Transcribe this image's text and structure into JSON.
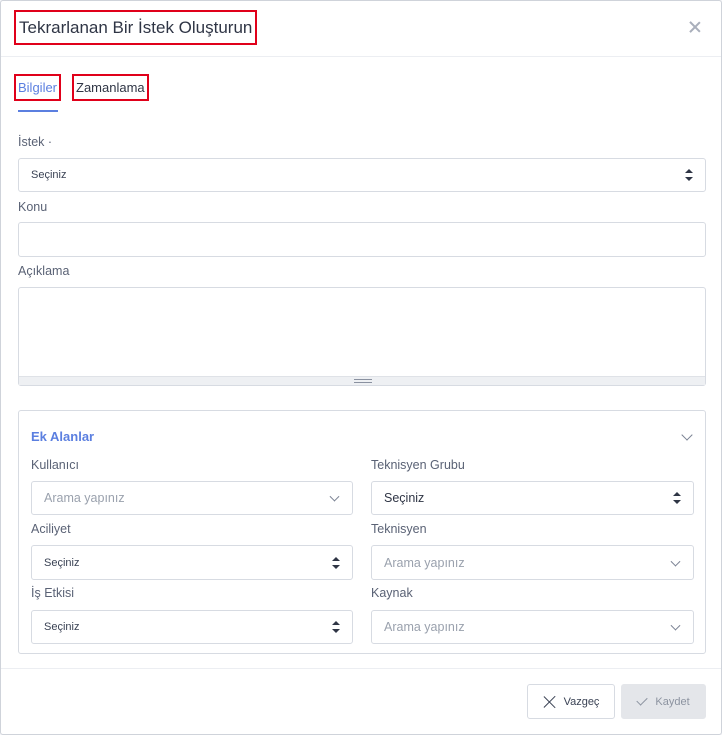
{
  "dialog": {
    "title": "Tekrarlanan Bir İstek Oluşturun"
  },
  "tabs": [
    {
      "label": "Bilgiler",
      "active": true
    },
    {
      "label": "Zamanlama",
      "active": false
    }
  ],
  "form": {
    "request_label": "İstek ·",
    "request_value": "Seçiniz",
    "subject_label": "Konu",
    "subject_value": "",
    "description_label": "Açıklama",
    "description_value": ""
  },
  "extra_fields": {
    "title": "Ek Alanlar",
    "user_label": "Kullanıcı",
    "user_placeholder": "Arama yapınız",
    "tech_group_label": "Teknisyen Grubu",
    "tech_group_value": "Seçiniz",
    "urgency_label": "Aciliyet",
    "urgency_value": "Seçiniz",
    "technician_label": "Teknisyen",
    "technician_placeholder": "Arama yapınız",
    "impact_label": "İş Etkisi",
    "impact_value": "Seçiniz",
    "source_label": "Kaynak",
    "source_placeholder": "Arama yapınız"
  },
  "footer": {
    "cancel_label": "Vazgeç",
    "save_label": "Kaydet"
  },
  "colors": {
    "accent": "#5b7fe0",
    "highlight_border": "#e0001a",
    "disabled_button": "#e4e6ea"
  }
}
